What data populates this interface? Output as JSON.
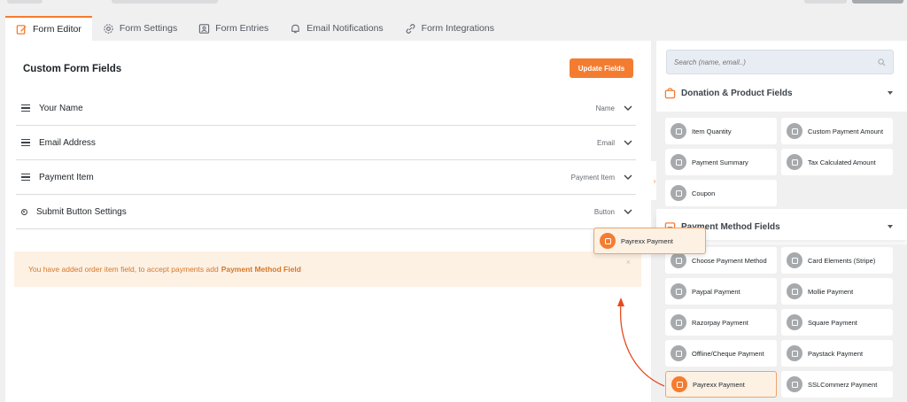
{
  "tabs": [
    {
      "label": "Form Editor",
      "icon": "edit-icon"
    },
    {
      "label": "Form Settings",
      "icon": "gear-icon"
    },
    {
      "label": "Form Entries",
      "icon": "user-card-icon"
    },
    {
      "label": "Email Notifications",
      "icon": "bell-icon"
    },
    {
      "label": "Form Integrations",
      "icon": "link-icon"
    }
  ],
  "editor": {
    "title": "Custom Form Fields",
    "update_label": "Update Fields",
    "fields": [
      {
        "label": "Your Name",
        "type": "Name"
      },
      {
        "label": "Email Address",
        "type": "Email"
      },
      {
        "label": "Payment Item",
        "type": "Payment Item"
      },
      {
        "label": "Submit Button Settings",
        "type": "Button"
      }
    ],
    "notice": {
      "text": "You have added order item field, to accept payments add",
      "link": "Payment Method Field",
      "close": "×"
    }
  },
  "sidebar": {
    "search_placeholder": "Search (name, email..)",
    "sections": [
      {
        "title": "Donation & Product Fields",
        "items": [
          "Item Quantity",
          "Custom Payment Amount",
          "Payment Summary",
          "Tax Calculated Amount",
          "Coupon"
        ]
      },
      {
        "title": "Payment Method Fields",
        "items": [
          "Choose Payment Method",
          "Card Elements (Stripe)",
          "Paypal Payment",
          "Mollie Payment",
          "Razorpay Payment",
          "Square Payment",
          "Offline/Cheque Payment",
          "Paystack Payment",
          "Payrexx Payment",
          "SSLCommerz Payment"
        ]
      }
    ],
    "collapse_glyph": "›"
  },
  "drag_ghost": {
    "label": "Payrexx Payment"
  },
  "colors": {
    "accent": "#f47c30",
    "notice_bg": "#fdf1e4",
    "notice_text": "#d97724"
  }
}
